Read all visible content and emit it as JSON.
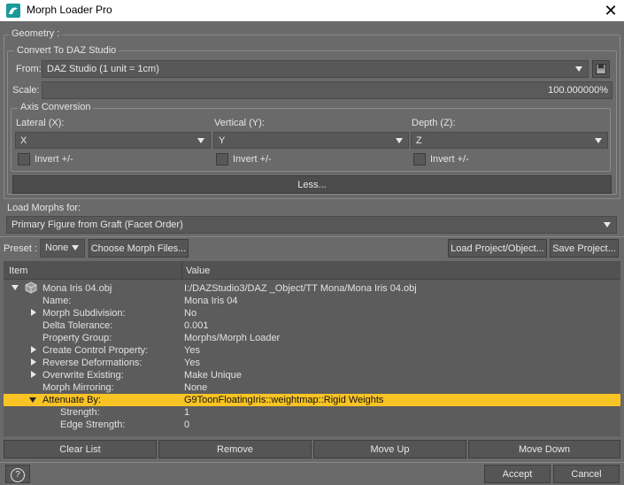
{
  "window": {
    "title": "Morph Loader Pro"
  },
  "geometry": {
    "group_label": "Geometry :",
    "convert_label": "Convert To DAZ Studio",
    "from_label": "From:",
    "from_value": "DAZ Studio (1 unit = 1cm)",
    "scale_label": "Scale:",
    "scale_value": "100.000000%",
    "axis_label": "Axis Conversion",
    "lateral_label": "Lateral (X):",
    "vertical_label": "Vertical (Y):",
    "depth_label": "Depth (Z):",
    "lateral_value": "X",
    "vertical_value": "Y",
    "depth_value": "Z",
    "invert_label": "Invert +/-",
    "less_button": "Less..."
  },
  "load_morphs": {
    "label": "Load Morphs for:",
    "value": "Primary Figure from Graft (Facet Order)"
  },
  "toolbar": {
    "preset_label": "Preset :",
    "preset_value": "None",
    "choose_button": "Choose Morph Files...",
    "load_project_button": "Load Project/Object...",
    "save_project_button": "Save Project..."
  },
  "tree": {
    "col_item": "Item",
    "col_value": "Value",
    "rows": [
      {
        "item": "Mona Iris 04.obj",
        "value": "I:/DAZStudio3/DAZ _Object/TT Mona/Mona Iris 04.obj"
      },
      {
        "item": "Name:",
        "value": "Mona Iris 04"
      },
      {
        "item": "Morph Subdivision:",
        "value": "No"
      },
      {
        "item": "Delta Tolerance:",
        "value": "0.001"
      },
      {
        "item": "Property Group:",
        "value": "Morphs/Morph Loader"
      },
      {
        "item": "Create Control Property:",
        "value": "Yes"
      },
      {
        "item": "Reverse Deformations:",
        "value": "Yes"
      },
      {
        "item": "Overwrite Existing:",
        "value": "Make Unique"
      },
      {
        "item": "Morph Mirroring:",
        "value": "None"
      },
      {
        "item": "Attenuate By:",
        "value": "G9ToonFloatingIris::weightmap::Rigid Weights"
      },
      {
        "item": "Strength:",
        "value": "1"
      },
      {
        "item": "Edge Strength:",
        "value": "0"
      }
    ]
  },
  "list_buttons": {
    "clear": "Clear List",
    "remove": "Remove",
    "move_up": "Move Up",
    "move_down": "Move Down"
  },
  "footer": {
    "help_icon": "?",
    "accept": "Accept",
    "cancel": "Cancel"
  },
  "colors": {
    "highlight": "#f7c325",
    "background": "#6a6a6a"
  }
}
